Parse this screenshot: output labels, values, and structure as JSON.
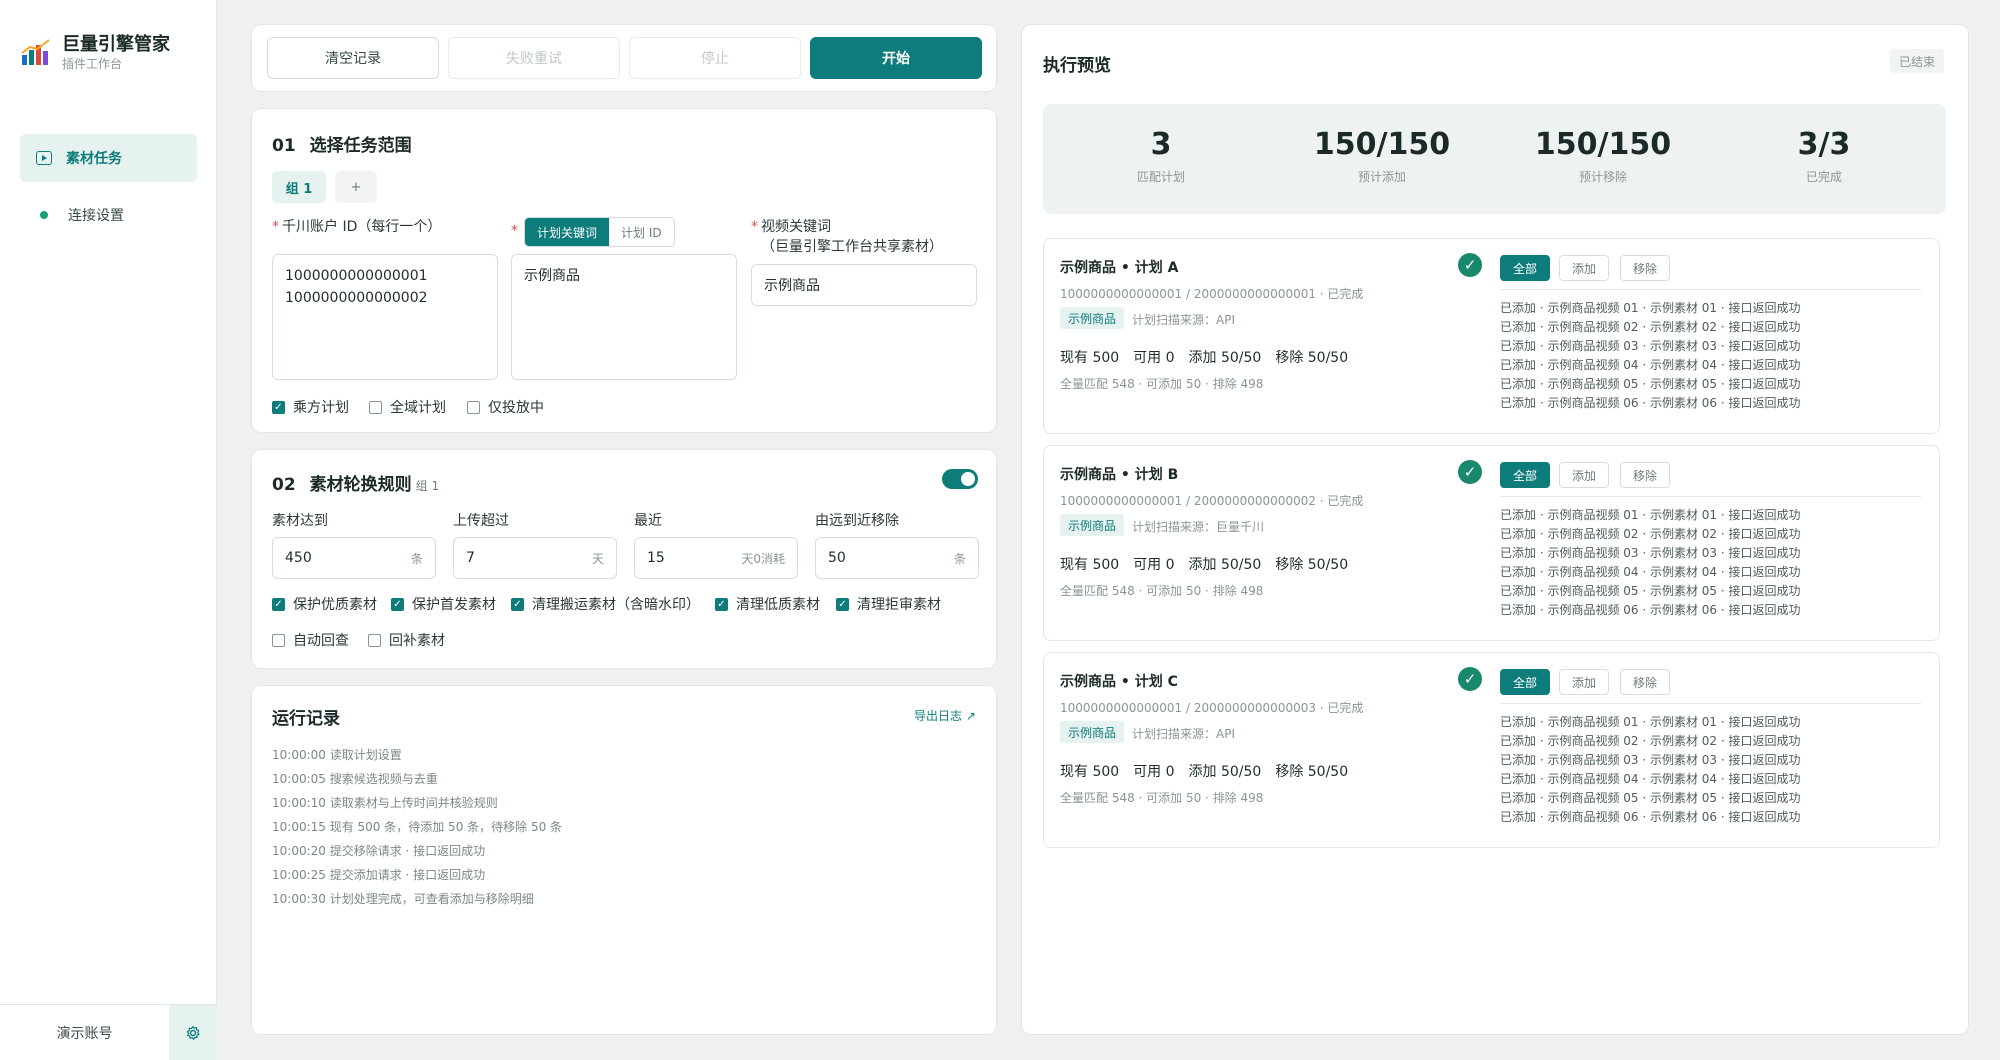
{
  "brand": {
    "title": "巨量引擎管家",
    "subtitle": "插件工作台"
  },
  "nav": [
    {
      "label": "素材任务",
      "active": true
    },
    {
      "label": "连接设置",
      "active": false
    }
  ],
  "footer": {
    "account": "演示账号"
  },
  "toolbar": {
    "clear": "清空记录",
    "retry": "失败重试",
    "stop": "停止",
    "start": "开始"
  },
  "scope": {
    "num": "01",
    "title": "选择任务范围",
    "group_tab": "组 1",
    "add_tab": "+",
    "account_label": "千川账户 ID（每行一个）",
    "account_value": "1000000000000001\n1000000000000002",
    "mode_keyword": "计划关键词",
    "mode_id": "计划 ID",
    "keyword_value": "示例商品",
    "video_label_1": "视频关键词",
    "video_label_2": "（巨量引擎工作台共享素材）",
    "video_value": "示例商品",
    "checks": [
      {
        "label": "乘方计划",
        "checked": true
      },
      {
        "label": "全域计划",
        "checked": false
      },
      {
        "label": "仅投放中",
        "checked": false
      }
    ]
  },
  "rules": {
    "num": "02",
    "title": "素材轮换规则",
    "group": "组 1",
    "enabled": true,
    "fields": [
      {
        "label": "素材达到",
        "value": "450",
        "unit": "条"
      },
      {
        "label": "上传超过",
        "value": "7",
        "unit": "天"
      },
      {
        "label": "最近",
        "value": "15",
        "unit": "天0消耗"
      },
      {
        "label": "由远到近移除",
        "value": "50",
        "unit": "条"
      }
    ],
    "checks_row1": [
      {
        "label": "保护优质素材",
        "checked": true
      },
      {
        "label": "保护首发素材",
        "checked": true
      },
      {
        "label": "清理搬运素材（含暗水印）",
        "checked": true
      },
      {
        "label": "清理低质素材",
        "checked": true
      },
      {
        "label": "清理拒审素材",
        "checked": true
      }
    ],
    "checks_row2": [
      {
        "label": "自动回查",
        "checked": false
      },
      {
        "label": "回补素材",
        "checked": false
      }
    ]
  },
  "log": {
    "title": "运行记录",
    "export": "导出日志 ↗",
    "lines": [
      "10:00:00 读取计划设置",
      "10:00:05 搜索候选视频与去重",
      "10:00:10 读取素材与上传时间并核验规则",
      "10:00:15 现有 500 条，待添加 50 条，待移除 50 条",
      "10:00:20 提交移除请求 · 接口返回成功",
      "10:00:25 提交添加请求 · 接口返回成功",
      "10:00:30 计划处理完成，可查看添加与移除明细"
    ]
  },
  "preview": {
    "title": "执行预览",
    "status": "已结束",
    "stats": [
      {
        "value": "3",
        "label": "匹配计划"
      },
      {
        "value": "150/150",
        "label": "预计添加"
      },
      {
        "value": "150/150",
        "label": "预计移除"
      },
      {
        "value": "3/3",
        "label": "已完成"
      }
    ],
    "filters": [
      "全部",
      "添加",
      "移除"
    ],
    "plans": [
      {
        "title": "示例商品 • 计划 A",
        "ids": "1000000000000001 / 2000000000000001 · 已完成",
        "tag": "示例商品",
        "source": "计划扫描来源：API",
        "counts": [
          "现有 500",
          "可用 0",
          "添加 50/50",
          "移除 50/50"
        ],
        "match": "全量匹配 548 · 可添加 50 · 排除 498",
        "results": [
          "已添加 · 示例商品视频 01 · 示例素材 01 · 接口返回成功",
          "已添加 · 示例商品视频 02 · 示例素材 02 · 接口返回成功",
          "已添加 · 示例商品视频 03 · 示例素材 03 · 接口返回成功",
          "已添加 · 示例商品视频 04 · 示例素材 04 · 接口返回成功",
          "已添加 · 示例商品视频 05 · 示例素材 05 · 接口返回成功",
          "已添加 · 示例商品视频 06 · 示例素材 06 · 接口返回成功"
        ]
      },
      {
        "title": "示例商品 • 计划 B",
        "ids": "1000000000000001 / 2000000000000002 · 已完成",
        "tag": "示例商品",
        "source": "计划扫描来源：巨量千川",
        "counts": [
          "现有 500",
          "可用 0",
          "添加 50/50",
          "移除 50/50"
        ],
        "match": "全量匹配 548 · 可添加 50 · 排除 498",
        "results": [
          "已添加 · 示例商品视频 01 · 示例素材 01 · 接口返回成功",
          "已添加 · 示例商品视频 02 · 示例素材 02 · 接口返回成功",
          "已添加 · 示例商品视频 03 · 示例素材 03 · 接口返回成功",
          "已添加 · 示例商品视频 04 · 示例素材 04 · 接口返回成功",
          "已添加 · 示例商品视频 05 · 示例素材 05 · 接口返回成功",
          "已添加 · 示例商品视频 06 · 示例素材 06 · 接口返回成功"
        ]
      },
      {
        "title": "示例商品 • 计划 C",
        "ids": "1000000000000001 / 2000000000000003 · 已完成",
        "tag": "示例商品",
        "source": "计划扫描来源：API",
        "counts": [
          "现有 500",
          "可用 0",
          "添加 50/50",
          "移除 50/50"
        ],
        "match": "全量匹配 548 · 可添加 50 · 排除 498",
        "results": [
          "已添加 · 示例商品视频 01 · 示例素材 01 · 接口返回成功",
          "已添加 · 示例商品视频 02 · 示例素材 02 · 接口返回成功",
          "已添加 · 示例商品视频 03 · 示例素材 03 · 接口返回成功",
          "已添加 · 示例商品视频 04 · 示例素材 04 · 接口返回成功",
          "已添加 · 示例商品视频 05 · 示例素材 05 · 接口返回成功",
          "已添加 · 示例商品视频 06 · 示例素材 06 · 接口返回成功"
        ]
      }
    ]
  }
}
